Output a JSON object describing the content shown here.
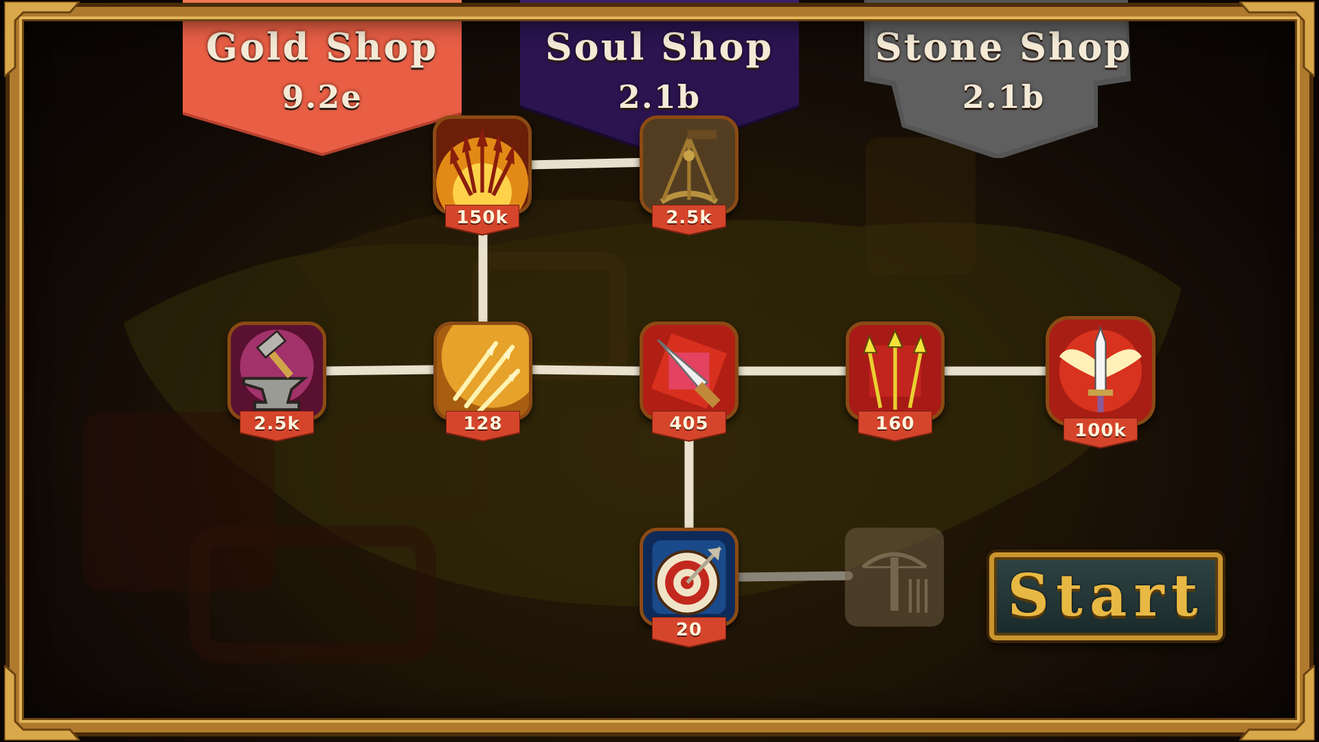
{
  "shops": [
    {
      "title": "Gold Shop",
      "amount": "9.2e",
      "color": "#e95f45"
    },
    {
      "title": "Soul Shop",
      "amount": "2.1b",
      "color": "#2b1450"
    },
    {
      "title": "Stone Shop",
      "amount": "2.1b",
      "color": "#5a5a5a"
    }
  ],
  "nodes": [
    {
      "icon": "flame-spears-icon",
      "price": "150k"
    },
    {
      "icon": "sextant-icon",
      "price": "2.5k"
    },
    {
      "icon": "hammer-anvil-icon",
      "price": "2.5k"
    },
    {
      "icon": "golden-arrows-icon",
      "price": "128"
    },
    {
      "icon": "dagger-icon",
      "price": "405"
    },
    {
      "icon": "triple-arrows-icon",
      "price": "160"
    },
    {
      "icon": "winged-sword-icon",
      "price": "100k"
    },
    {
      "icon": "target-icon",
      "price": "20"
    },
    {
      "icon": "crossbow-icon",
      "price": null,
      "locked": true
    }
  ],
  "start_label": "Start",
  "colors": {
    "frame": "#b07a2e",
    "price_ribbon": "#d5452c",
    "start_text": "#e8b844"
  }
}
